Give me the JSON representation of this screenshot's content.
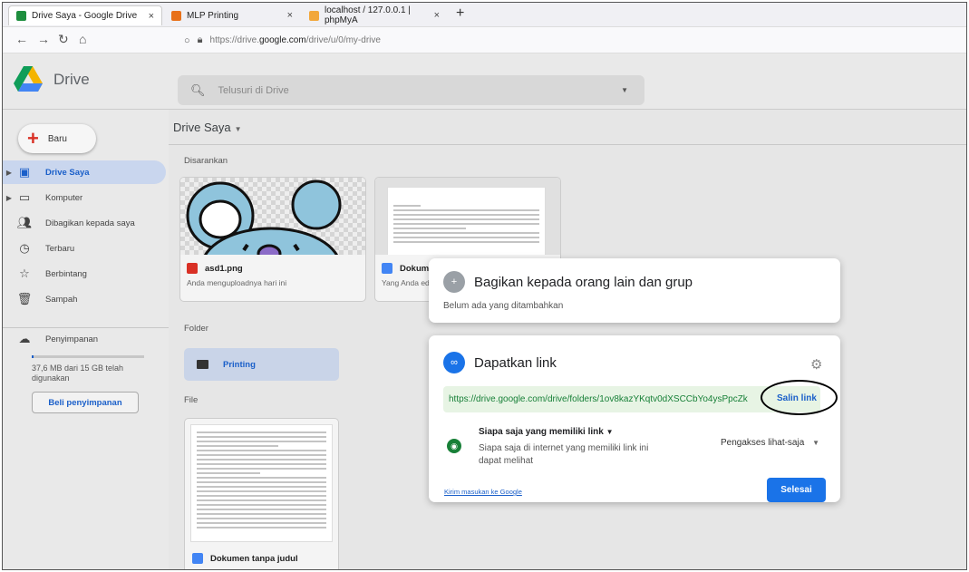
{
  "browser": {
    "tabs": [
      {
        "title": "Drive Saya - Google Drive",
        "color": "#1e8e3e"
      },
      {
        "title": "MLP Printing",
        "color": "#e8711a"
      },
      {
        "title": "localhost / 127.0.0.1 | phpMyA",
        "color": "#f2a73b"
      }
    ],
    "close_glyph": "×",
    "new_tab": "+",
    "url_prefix": "https://drive.",
    "url_domain": "google.com",
    "url_path": "/drive/u/0/my-drive"
  },
  "header": {
    "brand": "Drive",
    "search_placeholder": "Telusuri di Drive"
  },
  "sidebar": {
    "new_label": "Baru",
    "items": [
      {
        "label": "Drive Saya",
        "icon": "my-drive-icon"
      },
      {
        "label": "Komputer",
        "icon": "computer-icon"
      },
      {
        "label": "Dibagikan kepada saya",
        "icon": "shared-icon"
      },
      {
        "label": "Terbaru",
        "icon": "clock-icon"
      },
      {
        "label": "Berbintang",
        "icon": "star-icon"
      },
      {
        "label": "Sampah",
        "icon": "trash-icon"
      }
    ],
    "storage_label": "Penyimpanan",
    "storage_text": "37,6 MB dari 15 GB telah digunakan",
    "storage_fraction": 0.0025,
    "buy_label": "Beli penyimpanan"
  },
  "main": {
    "title": "Drive Saya",
    "suggested_label": "Disarankan",
    "suggested": [
      {
        "name": "asd1.png",
        "sub": "Anda menguploadnya hari ini",
        "icon_color": "#d93025"
      },
      {
        "name": "Dokumen tanpa judul",
        "sub": "Yang Anda edit hari ini",
        "icon_color": "#4285f4"
      }
    ],
    "folder_label": "Folder",
    "folder_name": "Printing",
    "file_label": "File",
    "file_name": "Dokumen tanpa judul"
  },
  "share_dialog": {
    "title": "Bagikan kepada orang lain dan grup",
    "subtitle": "Belum ada yang ditambahkan"
  },
  "link_dialog": {
    "title": "Dapatkan link",
    "link": "https://drive.google.com/drive/folders/1ov8kazYKqtv0dXSCCbYo4ysPpcZk",
    "copy_label": "Salin link",
    "access_title": "Siapa saja yang memiliki link",
    "access_desc": "Siapa saja di internet yang memiliki link ini dapat melihat",
    "role": "Pengakses lihat-saja",
    "feedback": "Kirim masukan ke Google",
    "done_label": "Selesai"
  },
  "colors": {
    "accent": "#1a73e8",
    "link_green": "#188038",
    "active_nav": "#c9d6ee"
  }
}
